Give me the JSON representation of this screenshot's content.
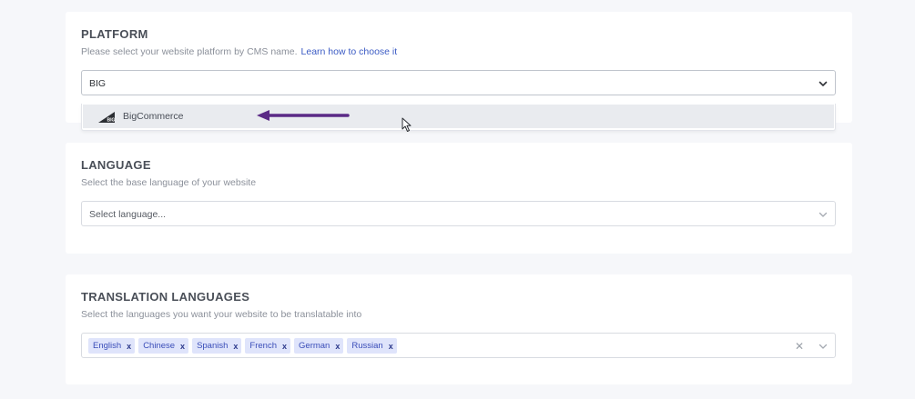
{
  "platform": {
    "title": "PLATFORM",
    "description": "Please select your website platform by CMS name.",
    "help_link": "Learn how to choose it",
    "input_value": "BIG",
    "dropdown_options": [
      {
        "label": "BigCommerce",
        "icon": "bigcommerce-logo-icon"
      }
    ]
  },
  "language": {
    "title": "LANGUAGE",
    "description": "Select the base language of your website",
    "placeholder": "Select language..."
  },
  "translation": {
    "title": "TRANSLATION LANGUAGES",
    "description": "Select the languages you want your website to be translatable into",
    "tags": [
      "English",
      "Chinese",
      "Spanish",
      "French",
      "German",
      "Russian"
    ],
    "tag_remove_glyph": "x",
    "clear_glyph": "✕"
  },
  "colors": {
    "accent": "#3b5bc4",
    "tag_bg": "#dfe4fb",
    "annotation_arrow": "#5b2a86"
  }
}
